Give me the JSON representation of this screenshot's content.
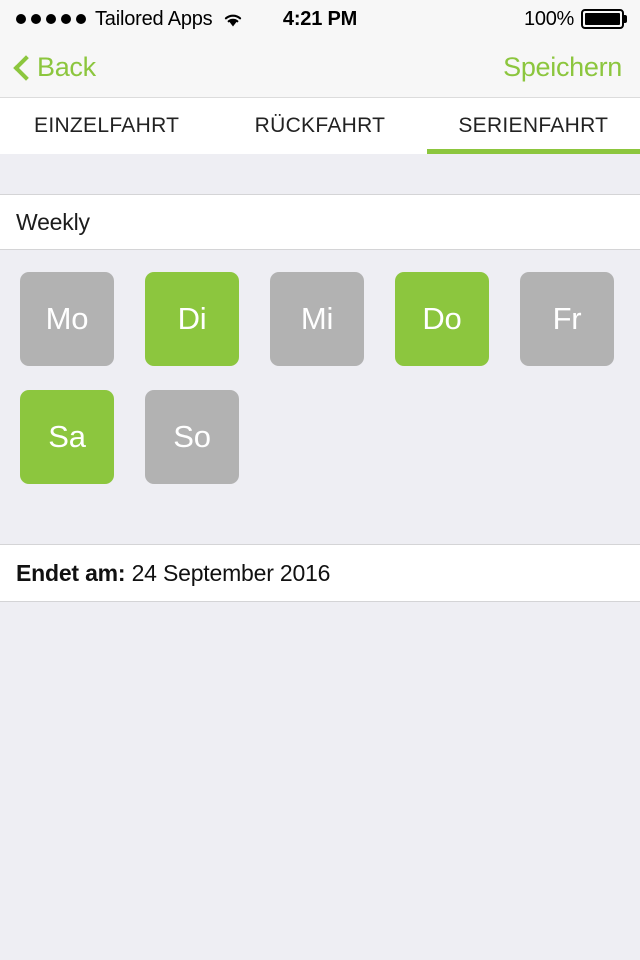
{
  "status_bar": {
    "signal_dots": 5,
    "carrier": "Tailored Apps",
    "wifi_icon": "wifi-icon",
    "time": "4:21 PM",
    "battery_percent": "100%",
    "battery_level": 100
  },
  "nav_bar": {
    "back_icon": "chevron-left-icon",
    "back_label": "Back",
    "save_label": "Speichern",
    "accent_color": "#8cc63e"
  },
  "tabs": [
    {
      "label": "EINZELFAHRT",
      "active": false
    },
    {
      "label": "RÜCKFAHRT",
      "active": false
    },
    {
      "label": "SERIENFAHRT",
      "active": true
    }
  ],
  "frequency": {
    "label": "Weekly"
  },
  "days": [
    {
      "label": "Mo",
      "selected": false
    },
    {
      "label": "Di",
      "selected": true
    },
    {
      "label": "Mi",
      "selected": false
    },
    {
      "label": "Do",
      "selected": true
    },
    {
      "label": "Fr",
      "selected": false
    },
    {
      "label": "Sa",
      "selected": true
    },
    {
      "label": "So",
      "selected": false
    }
  ],
  "end_date": {
    "label": "Endet am:",
    "value": "24 September 2016"
  },
  "colors": {
    "accent_green": "#8cc63e",
    "day_unselected_gray": "#b2b2b2",
    "page_background": "#eeeef3",
    "bar_background": "#f7f7f7",
    "row_background": "#ffffff"
  }
}
